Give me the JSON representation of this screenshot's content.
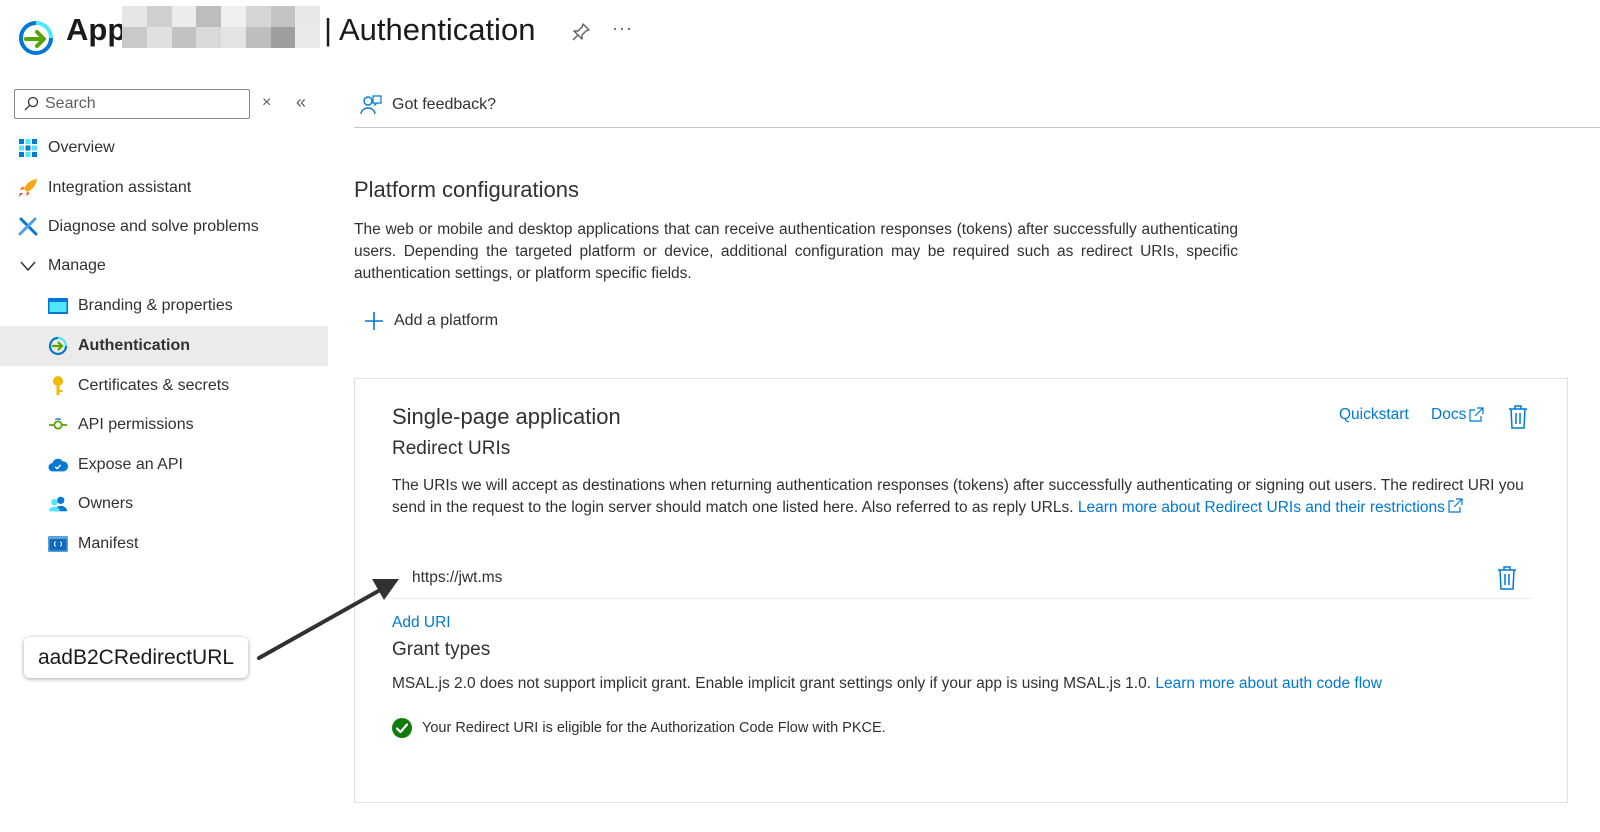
{
  "header": {
    "app_name": "App",
    "page_title": "| Authentication",
    "more_label": "···"
  },
  "sidebar": {
    "search": {
      "placeholder": "Search"
    },
    "clear_label": "×",
    "collapse_label": "«",
    "items": [
      {
        "label": "Overview",
        "icon": "overview-grid-icon"
      },
      {
        "label": "Integration assistant",
        "icon": "rocket-icon"
      },
      {
        "label": "Diagnose and solve problems",
        "icon": "wrench-icon"
      },
      {
        "label": "Manage",
        "icon": "chevron-down-icon",
        "expanded": true
      },
      {
        "label": "Branding & properties",
        "icon": "branding-icon"
      },
      {
        "label": "Authentication",
        "icon": "authentication-icon",
        "active": true
      },
      {
        "label": "Certificates & secrets",
        "icon": "key-icon"
      },
      {
        "label": "API permissions",
        "icon": "api-permissions-icon"
      },
      {
        "label": "Expose an API",
        "icon": "cloud-icon"
      },
      {
        "label": "Owners",
        "icon": "people-icon"
      },
      {
        "label": "Manifest",
        "icon": "manifest-icon"
      }
    ]
  },
  "main": {
    "feedback_label": "Got feedback?",
    "platform_title": "Platform configurations",
    "platform_desc": "The web or mobile and desktop applications that can receive authentication responses (tokens) after successfully authenticating users. Depending the targeted platform or device, additional configuration may be required such as redirect URIs, specific authentication settings, or platform specific fields.",
    "add_platform_label": "Add a platform",
    "card": {
      "title": "Single-page application",
      "quickstart_label": "Quickstart",
      "docs_label": "Docs",
      "redirect_title": "Redirect URIs",
      "redirect_desc": "The URIs we will accept as destinations when returning authentication responses (tokens) after successfully authenticating or signing out users. The redirect URI you send in the request to the login server should match one listed here. Also referred to as reply URLs.",
      "redirect_link_label": "Learn more about Redirect URIs and their restrictions",
      "uri_value": "https://jwt.ms",
      "add_uri_label": "Add URI",
      "grant_title": "Grant types",
      "grant_desc": "MSAL.js 2.0 does not support implicit grant. Enable implicit grant settings only if your app is using MSAL.js 1.0.",
      "grant_link_label": "Learn more about auth code flow",
      "pkce_message": "Your Redirect URI is eligible for the Authorization Code Flow with PKCE."
    }
  },
  "annotation": {
    "callout_label": "aadB2CRedirectURL"
  },
  "colors": {
    "accent": "#0078d4",
    "success": "#107c10",
    "active_bg": "#edebe9"
  }
}
